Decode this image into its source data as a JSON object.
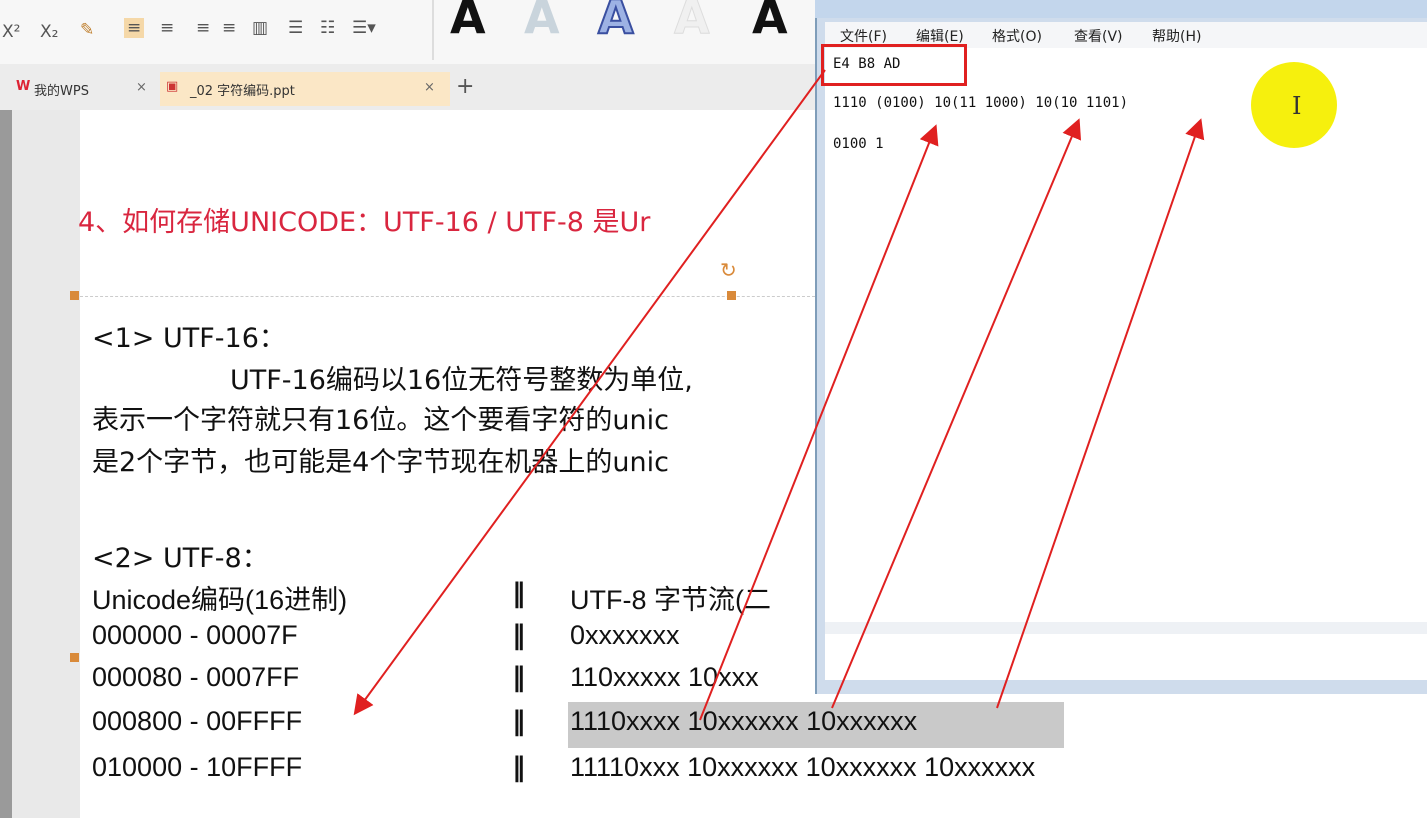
{
  "toolbar": {
    "superscript": "X²",
    "subscript": "X₂",
    "big_letters": [
      "A",
      "A",
      "A",
      "A",
      "A"
    ]
  },
  "tabs": {
    "wps": "我的WPS",
    "ppt": "_02 字符编码.ppt",
    "close": "×",
    "add": "+"
  },
  "slide": {
    "heading": "4、如何存储UNICODE：UTF-16 / UTF-8 是Ur",
    "utf16_title": "<1> UTF-16：",
    "utf16_line1": "UTF-16编码以16位无符号整数为单位,",
    "utf16_line2": "表示一个字符就只有16位。这个要看字符的unic",
    "utf16_line3": "是2个字节，也可能是4个字节现在机器上的unic",
    "utf8_title": "<2> UTF-8：",
    "table": {
      "left_header": "Unicode编码(16进制)",
      "right_header": "UTF-8 字节流(二",
      "rows": [
        {
          "range": "000000 - 00007F",
          "bytes": "0xxxxxxx"
        },
        {
          "range": "000080 - 0007FF",
          "bytes": "110xxxxx 10xxx"
        },
        {
          "range": "000800 - 00FFFF",
          "bytes": "1110xxxx 10xxxxxx 10xxxxxx"
        },
        {
          "range": "010000 - 10FFFF",
          "bytes": "11110xxx 10xxxxxx 10xxxxxx 10xxxxxx"
        }
      ],
      "separator": "‖"
    }
  },
  "notepad": {
    "menu": [
      "文件(F)",
      "编辑(E)",
      "格式(O)",
      "查看(V)",
      "帮助(H)"
    ],
    "lines": [
      "E4 B8 AD",
      "1110 (0100) 10(11 1000) 10(10 1101)",
      "0100 1"
    ],
    "text_cursor": "I"
  },
  "colors": {
    "heading": "#d9263f",
    "annotation": "#e02020",
    "cursor_highlight": "#f6ef00"
  }
}
